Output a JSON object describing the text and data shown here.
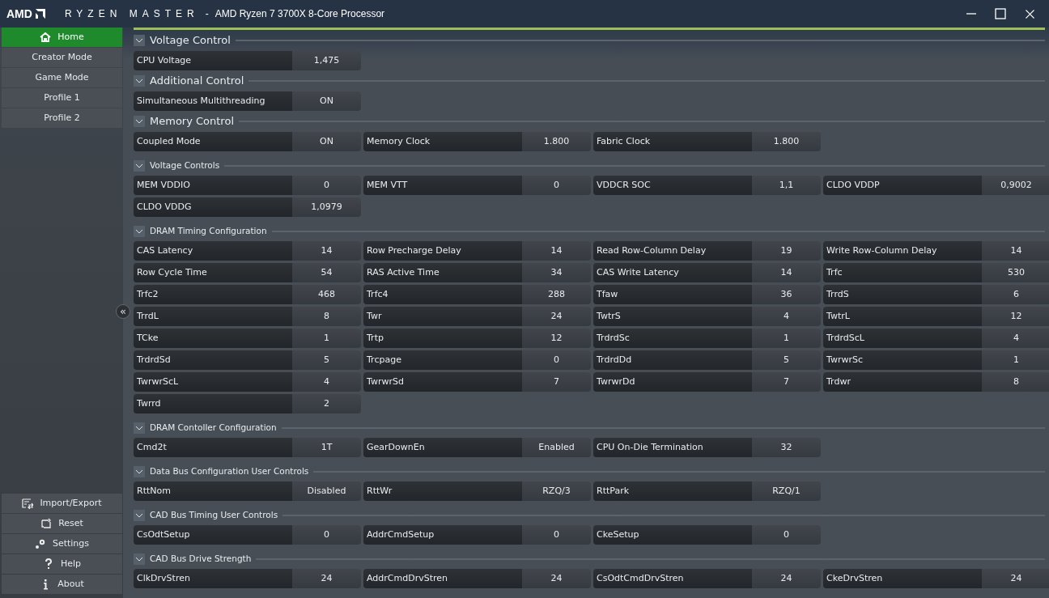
{
  "window": {
    "logo": "AMD",
    "app_name": "RYZEN MASTER",
    "separator": "-",
    "title": "AMD Ryzen 7 3700X 8-Core Processor"
  },
  "sidebar": {
    "items": [
      {
        "label": "Home",
        "kind": "home",
        "selected": true
      },
      {
        "label": "Creator Mode",
        "selected": false
      },
      {
        "label": "Game Mode",
        "selected": false
      },
      {
        "label": "Profile 1",
        "selected": false
      },
      {
        "label": "Profile 2",
        "selected": false
      }
    ],
    "bottom_items": [
      {
        "label": "Import/Export",
        "kind": "import"
      },
      {
        "label": "Reset",
        "kind": "reset"
      },
      {
        "label": "Settings",
        "kind": "settings"
      },
      {
        "label": "Help",
        "kind": "help"
      },
      {
        "label": "About",
        "kind": "about"
      }
    ],
    "collapse_glyph": "«"
  },
  "sections": [
    {
      "title": "Voltage Control",
      "kind": "major",
      "expanded": true,
      "params": [
        {
          "label": "CPU Voltage",
          "value": "1,475"
        }
      ]
    },
    {
      "title": "Additional Control",
      "kind": "major",
      "expanded": true,
      "params": [
        {
          "label": "Simultaneous Multithreading",
          "value": "ON"
        }
      ]
    },
    {
      "title": "Memory Control",
      "kind": "major",
      "expanded": true,
      "params": [
        {
          "label": "Coupled Mode",
          "value": "ON"
        },
        {
          "label": "Memory Clock",
          "value": "1.800"
        },
        {
          "label": "Fabric Clock",
          "value": "1.800"
        }
      ]
    },
    {
      "title": "Voltage Controls",
      "kind": "minor",
      "expanded": true,
      "params": [
        {
          "label": "MEM VDDIO",
          "value": "0"
        },
        {
          "label": "MEM VTT",
          "value": "0"
        },
        {
          "label": "VDDCR SOC",
          "value": "1,1"
        },
        {
          "label": "CLDO VDDP",
          "value": "0,9002"
        },
        {
          "label": "CLDO VDDG",
          "value": "1,0979"
        }
      ]
    },
    {
      "title": "DRAM Timing Configuration",
      "kind": "minor",
      "expanded": true,
      "params": [
        {
          "label": "CAS Latency",
          "value": "14"
        },
        {
          "label": "Row Precharge Delay",
          "value": "14"
        },
        {
          "label": "Read Row-Column Delay",
          "value": "19"
        },
        {
          "label": "Write Row-Column Delay",
          "value": "14"
        },
        {
          "label": "Row Cycle Time",
          "value": "54"
        },
        {
          "label": "RAS Active Time",
          "value": "34"
        },
        {
          "label": "CAS Write Latency",
          "value": "14"
        },
        {
          "label": "Trfc",
          "value": "530"
        },
        {
          "label": "Trfc2",
          "value": "468"
        },
        {
          "label": "Trfc4",
          "value": "288"
        },
        {
          "label": "Tfaw",
          "value": "36"
        },
        {
          "label": "TrrdS",
          "value": "6"
        },
        {
          "label": "TrrdL",
          "value": "8"
        },
        {
          "label": "Twr",
          "value": "24"
        },
        {
          "label": "TwtrS",
          "value": "4"
        },
        {
          "label": "TwtrL",
          "value": "12"
        },
        {
          "label": "TCke",
          "value": "1"
        },
        {
          "label": "Trtp",
          "value": "12"
        },
        {
          "label": "TrdrdSc",
          "value": "1"
        },
        {
          "label": "TrdrdScL",
          "value": "4"
        },
        {
          "label": "TrdrdSd",
          "value": "5"
        },
        {
          "label": "Trcpage",
          "value": "0"
        },
        {
          "label": "TrdrdDd",
          "value": "5"
        },
        {
          "label": "TwrwrSc",
          "value": "1"
        },
        {
          "label": "TwrwrScL",
          "value": "4"
        },
        {
          "label": "TwrwrSd",
          "value": "7"
        },
        {
          "label": "TwrwrDd",
          "value": "7"
        },
        {
          "label": "Trdwr",
          "value": "8"
        },
        {
          "label": "Twrrd",
          "value": "2"
        }
      ]
    },
    {
      "title": "DRAM Contoller Configuration",
      "kind": "minor",
      "expanded": true,
      "params": [
        {
          "label": "Cmd2t",
          "value": "1T"
        },
        {
          "label": "GearDownEn",
          "value": "Enabled"
        },
        {
          "label": "CPU On-Die Termination",
          "value": "32"
        }
      ]
    },
    {
      "title": "Data Bus Configuration User Controls",
      "kind": "minor",
      "expanded": true,
      "params": [
        {
          "label": "RttNom",
          "value": "Disabled"
        },
        {
          "label": "RttWr",
          "value": "RZQ/3"
        },
        {
          "label": "RttPark",
          "value": "RZQ/1"
        }
      ]
    },
    {
      "title": "CAD Bus Timing User Controls",
      "kind": "minor",
      "expanded": true,
      "params": [
        {
          "label": "CsOdtSetup",
          "value": "0"
        },
        {
          "label": "AddrCmdSetup",
          "value": "0"
        },
        {
          "label": "CkeSetup",
          "value": "0"
        }
      ]
    },
    {
      "title": "CAD Bus Drive Strength",
      "kind": "minor",
      "expanded": true,
      "params": [
        {
          "label": "ClkDrvStren",
          "value": "24"
        },
        {
          "label": "AddrCmdDrvStren",
          "value": "24"
        },
        {
          "label": "CsOdtCmdDrvStren",
          "value": "24"
        },
        {
          "label": "CkeDrvStren",
          "value": "24"
        }
      ]
    }
  ]
}
